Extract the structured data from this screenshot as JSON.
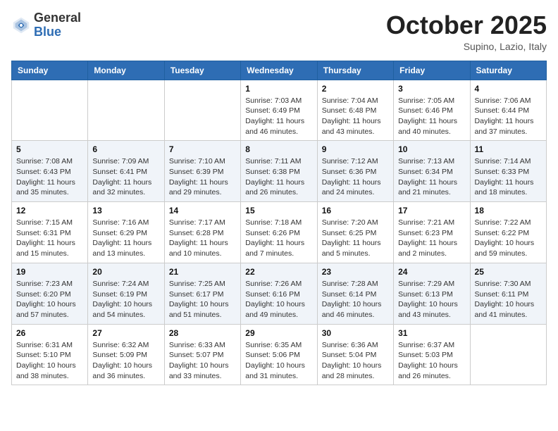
{
  "header": {
    "logo_general": "General",
    "logo_blue": "Blue",
    "month": "October 2025",
    "location": "Supino, Lazio, Italy"
  },
  "days_of_week": [
    "Sunday",
    "Monday",
    "Tuesday",
    "Wednesday",
    "Thursday",
    "Friday",
    "Saturday"
  ],
  "weeks": [
    [
      {
        "day": "",
        "info": ""
      },
      {
        "day": "",
        "info": ""
      },
      {
        "day": "",
        "info": ""
      },
      {
        "day": "1",
        "info": "Sunrise: 7:03 AM\nSunset: 6:49 PM\nDaylight: 11 hours and 46 minutes."
      },
      {
        "day": "2",
        "info": "Sunrise: 7:04 AM\nSunset: 6:48 PM\nDaylight: 11 hours and 43 minutes."
      },
      {
        "day": "3",
        "info": "Sunrise: 7:05 AM\nSunset: 6:46 PM\nDaylight: 11 hours and 40 minutes."
      },
      {
        "day": "4",
        "info": "Sunrise: 7:06 AM\nSunset: 6:44 PM\nDaylight: 11 hours and 37 minutes."
      }
    ],
    [
      {
        "day": "5",
        "info": "Sunrise: 7:08 AM\nSunset: 6:43 PM\nDaylight: 11 hours and 35 minutes."
      },
      {
        "day": "6",
        "info": "Sunrise: 7:09 AM\nSunset: 6:41 PM\nDaylight: 11 hours and 32 minutes."
      },
      {
        "day": "7",
        "info": "Sunrise: 7:10 AM\nSunset: 6:39 PM\nDaylight: 11 hours and 29 minutes."
      },
      {
        "day": "8",
        "info": "Sunrise: 7:11 AM\nSunset: 6:38 PM\nDaylight: 11 hours and 26 minutes."
      },
      {
        "day": "9",
        "info": "Sunrise: 7:12 AM\nSunset: 6:36 PM\nDaylight: 11 hours and 24 minutes."
      },
      {
        "day": "10",
        "info": "Sunrise: 7:13 AM\nSunset: 6:34 PM\nDaylight: 11 hours and 21 minutes."
      },
      {
        "day": "11",
        "info": "Sunrise: 7:14 AM\nSunset: 6:33 PM\nDaylight: 11 hours and 18 minutes."
      }
    ],
    [
      {
        "day": "12",
        "info": "Sunrise: 7:15 AM\nSunset: 6:31 PM\nDaylight: 11 hours and 15 minutes."
      },
      {
        "day": "13",
        "info": "Sunrise: 7:16 AM\nSunset: 6:29 PM\nDaylight: 11 hours and 13 minutes."
      },
      {
        "day": "14",
        "info": "Sunrise: 7:17 AM\nSunset: 6:28 PM\nDaylight: 11 hours and 10 minutes."
      },
      {
        "day": "15",
        "info": "Sunrise: 7:18 AM\nSunset: 6:26 PM\nDaylight: 11 hours and 7 minutes."
      },
      {
        "day": "16",
        "info": "Sunrise: 7:20 AM\nSunset: 6:25 PM\nDaylight: 11 hours and 5 minutes."
      },
      {
        "day": "17",
        "info": "Sunrise: 7:21 AM\nSunset: 6:23 PM\nDaylight: 11 hours and 2 minutes."
      },
      {
        "day": "18",
        "info": "Sunrise: 7:22 AM\nSunset: 6:22 PM\nDaylight: 10 hours and 59 minutes."
      }
    ],
    [
      {
        "day": "19",
        "info": "Sunrise: 7:23 AM\nSunset: 6:20 PM\nDaylight: 10 hours and 57 minutes."
      },
      {
        "day": "20",
        "info": "Sunrise: 7:24 AM\nSunset: 6:19 PM\nDaylight: 10 hours and 54 minutes."
      },
      {
        "day": "21",
        "info": "Sunrise: 7:25 AM\nSunset: 6:17 PM\nDaylight: 10 hours and 51 minutes."
      },
      {
        "day": "22",
        "info": "Sunrise: 7:26 AM\nSunset: 6:16 PM\nDaylight: 10 hours and 49 minutes."
      },
      {
        "day": "23",
        "info": "Sunrise: 7:28 AM\nSunset: 6:14 PM\nDaylight: 10 hours and 46 minutes."
      },
      {
        "day": "24",
        "info": "Sunrise: 7:29 AM\nSunset: 6:13 PM\nDaylight: 10 hours and 43 minutes."
      },
      {
        "day": "25",
        "info": "Sunrise: 7:30 AM\nSunset: 6:11 PM\nDaylight: 10 hours and 41 minutes."
      }
    ],
    [
      {
        "day": "26",
        "info": "Sunrise: 6:31 AM\nSunset: 5:10 PM\nDaylight: 10 hours and 38 minutes."
      },
      {
        "day": "27",
        "info": "Sunrise: 6:32 AM\nSunset: 5:09 PM\nDaylight: 10 hours and 36 minutes."
      },
      {
        "day": "28",
        "info": "Sunrise: 6:33 AM\nSunset: 5:07 PM\nDaylight: 10 hours and 33 minutes."
      },
      {
        "day": "29",
        "info": "Sunrise: 6:35 AM\nSunset: 5:06 PM\nDaylight: 10 hours and 31 minutes."
      },
      {
        "day": "30",
        "info": "Sunrise: 6:36 AM\nSunset: 5:04 PM\nDaylight: 10 hours and 28 minutes."
      },
      {
        "day": "31",
        "info": "Sunrise: 6:37 AM\nSunset: 5:03 PM\nDaylight: 10 hours and 26 minutes."
      },
      {
        "day": "",
        "info": ""
      }
    ]
  ]
}
